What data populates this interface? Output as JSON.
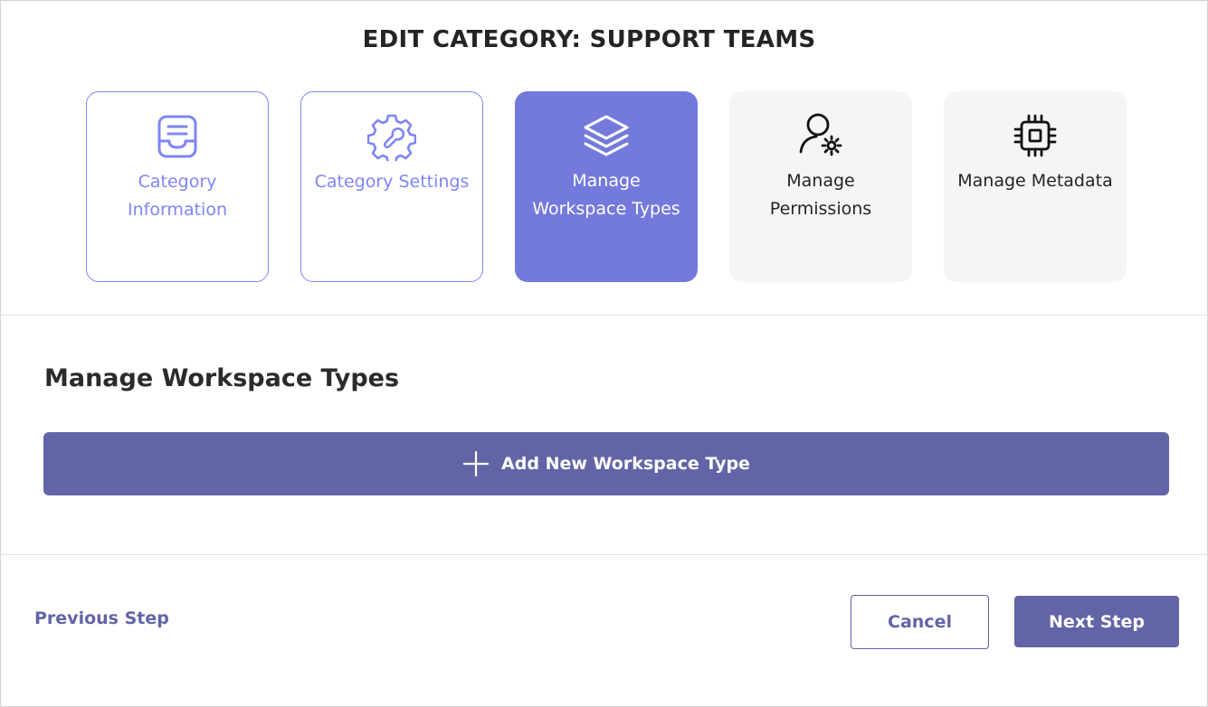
{
  "dialog": {
    "title": "EDIT CATEGORY: SUPPORT TEAMS"
  },
  "steps": [
    {
      "label": "Category Information",
      "icon": "inbox-tray-icon",
      "state": "completed"
    },
    {
      "label": "Category Settings",
      "icon": "gear-wrench-icon",
      "state": "completed"
    },
    {
      "label": "Manage Workspace Types",
      "icon": "layers-icon",
      "state": "active"
    },
    {
      "label": "Manage Permissions",
      "icon": "person-gear-icon",
      "state": "upcoming"
    },
    {
      "label": "Manage Metadata",
      "icon": "chip-icon",
      "state": "upcoming"
    }
  ],
  "section": {
    "title": "Manage Workspace Types",
    "add_button_label": "Add New Workspace Type",
    "add_button_icon": "plus-icon"
  },
  "footer": {
    "previous_label": "Previous Step",
    "cancel_label": "Cancel",
    "next_label": "Next Step"
  },
  "colors": {
    "accent": "#6264a7",
    "step_active_bg": "#7479dc",
    "step_done": "#7f85f5",
    "step_upcoming_bg": "#f5f5f5"
  }
}
